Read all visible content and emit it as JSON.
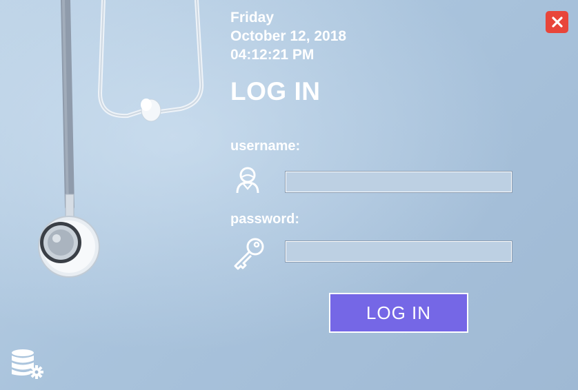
{
  "datetime": {
    "day": "Friday",
    "date": "October 12, 2018",
    "time": "04:12:21 PM"
  },
  "form": {
    "title": "LOG IN",
    "username_label": "username:",
    "password_label": "password:",
    "username_value": "",
    "password_value": "",
    "login_button": "LOG IN"
  },
  "icons": {
    "close": "close-icon",
    "user": "user-icon",
    "key": "key-icon",
    "database_settings": "database-settings-icon",
    "background": "stethoscope-image"
  },
  "colors": {
    "accent": "#7567e6",
    "close": "#e8453a",
    "text": "#ffffff",
    "background": "#a9c3dc"
  }
}
